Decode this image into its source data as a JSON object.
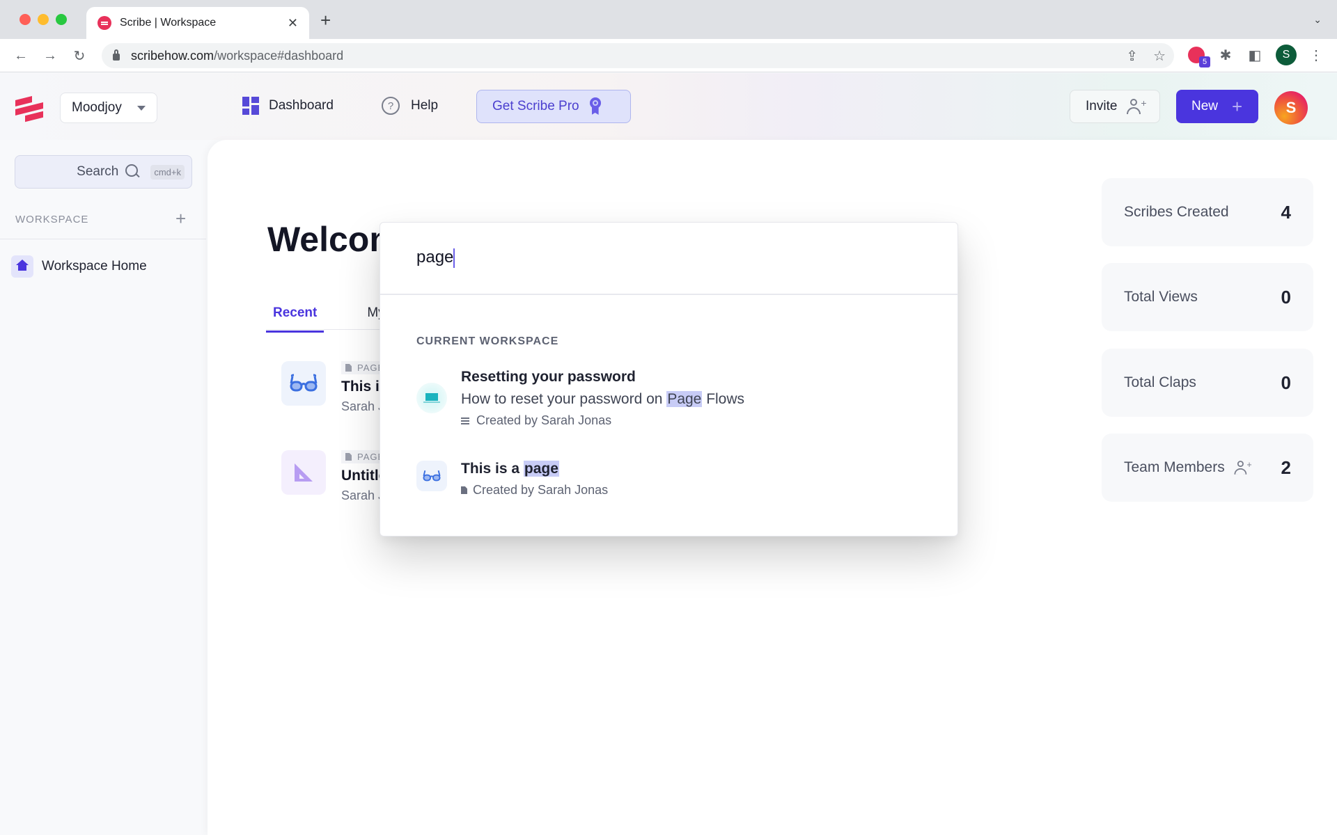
{
  "browser": {
    "tab_title": "Scribe | Workspace",
    "url_host": "scribehow.com",
    "url_path": "/workspace#dashboard",
    "extension_badge": "5",
    "profile_initial": "S"
  },
  "header": {
    "workspace_name": "Moodjoy",
    "nav": [
      {
        "label": "Dashboard",
        "icon": "dashboard-grid-icon"
      },
      {
        "label": "Help",
        "icon": "help-circle-icon"
      }
    ],
    "pro_label": "Get Scribe Pro",
    "invite_label": "Invite",
    "new_label": "New",
    "avatar_initial": "S"
  },
  "sidebar": {
    "search_label": "Search",
    "search_shortcut": "cmd+k",
    "section_label": "WORKSPACE",
    "items": [
      {
        "label": "Workspace Home",
        "icon": "home-icon",
        "active": true
      }
    ]
  },
  "main": {
    "welcome_text": "Welcome",
    "tabs": [
      {
        "label": "Recent",
        "active": true
      },
      {
        "label": "My Documents",
        "active": false
      }
    ],
    "recent": [
      {
        "type": "PAGE",
        "title": "This is a page",
        "author": "Sarah Jonas",
        "icon": "glasses-icon"
      },
      {
        "type": "PAGE",
        "title": "Untitled",
        "author": "Sarah Jonas",
        "icon": "triangle-ruler-icon"
      }
    ],
    "stats": [
      {
        "label": "Scribes Created",
        "value": "4"
      },
      {
        "label": "Total Views",
        "value": "0"
      },
      {
        "label": "Total Claps",
        "value": "0"
      },
      {
        "label": "Team Members",
        "value": "2",
        "icon": "user-plus-icon"
      }
    ]
  },
  "search_modal": {
    "query": "page",
    "section_label": "CURRENT WORKSPACE",
    "results": [
      {
        "title": "Resetting your password",
        "desc_before": "How to reset your password on ",
        "desc_highlight": "Page",
        "desc_after": " Flows",
        "meta": "Created by Sarah Jonas",
        "icon": "laptop-icon"
      },
      {
        "title_before": "This is a ",
        "title_highlight": "page",
        "meta": "Created by Sarah Jonas",
        "icon": "glasses-icon"
      }
    ]
  },
  "colors": {
    "brand": "#e8315a",
    "accent": "#4a35de",
    "highlight": "#c8ccf6"
  }
}
